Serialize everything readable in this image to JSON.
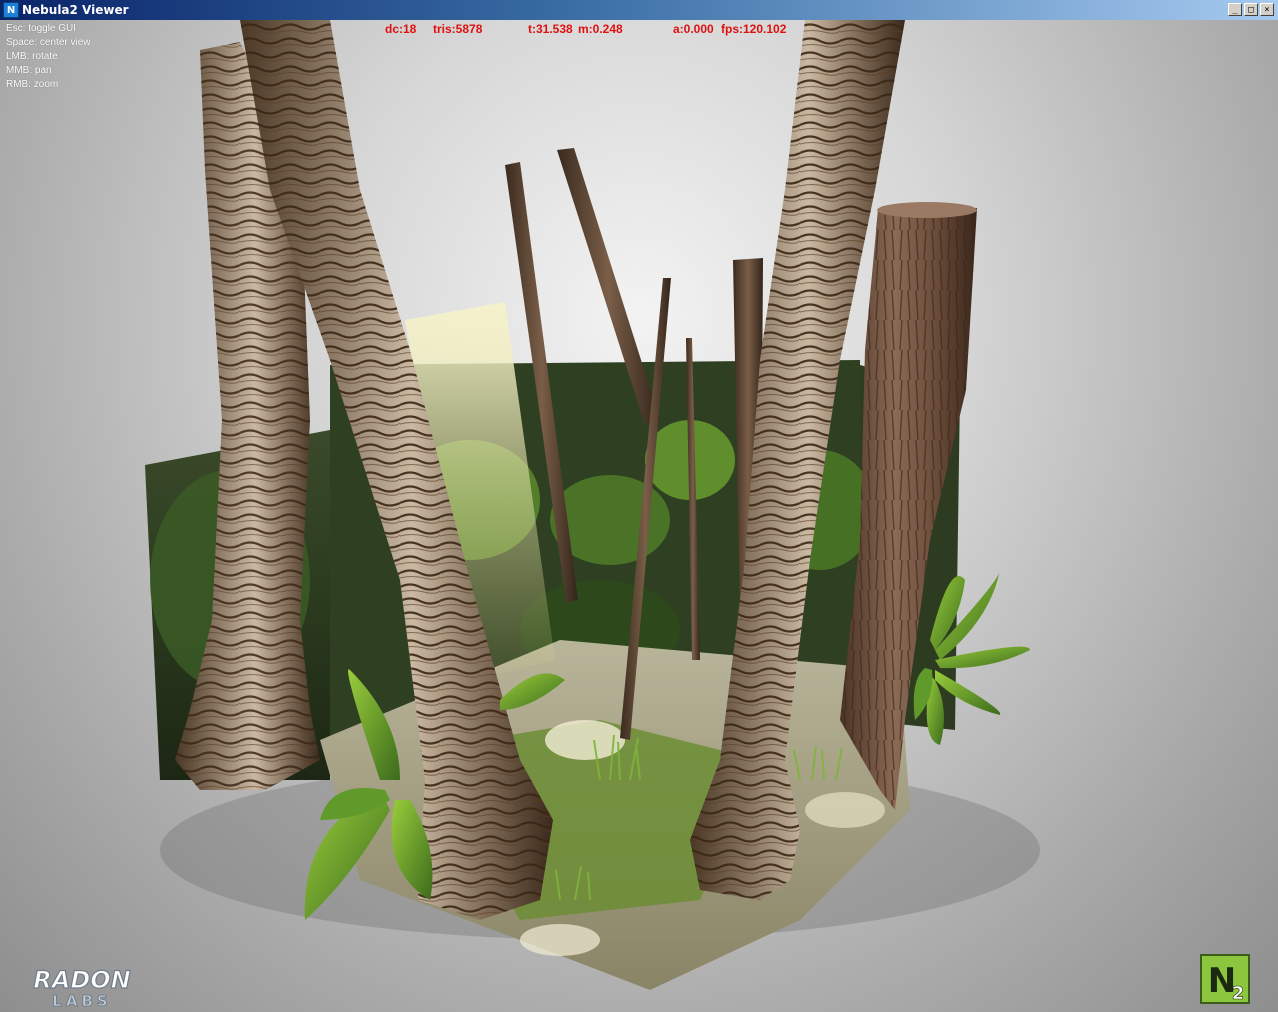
{
  "window": {
    "title": "Nebula2 Viewer",
    "icon_name": "nebula2-app-icon",
    "controls": [
      "minimize",
      "maximize",
      "close"
    ]
  },
  "help": {
    "lines": [
      "Esc: toggle GUI",
      "Space: center view",
      "LMB: rotate",
      "MMB: pan",
      "RMB: zoom"
    ]
  },
  "stats": {
    "dc": "dc:18",
    "tris": "tris:5878",
    "t": "t:31.538",
    "m": "m:0.248",
    "a": "a:0.000",
    "fps": "fps:120.102"
  },
  "logos": {
    "radon_line1": "RADON",
    "radon_line2": "LABS",
    "n2_main": "N",
    "n2_sub": "2"
  },
  "colors": {
    "stats_text": "#e01010",
    "titlebar_start": "#0a246a",
    "titlebar_end": "#a6caf0",
    "n2_logo": "#8cc63f"
  }
}
